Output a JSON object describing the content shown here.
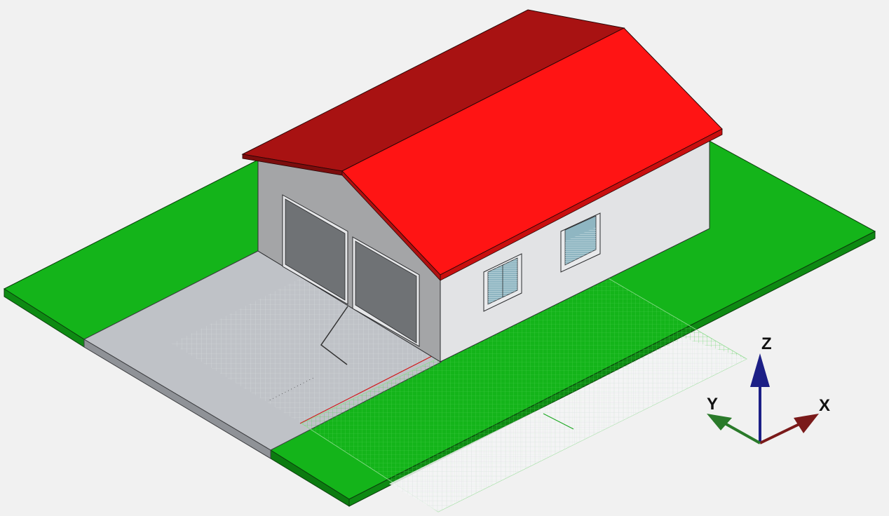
{
  "viewport": {
    "background": "#f1f1f1",
    "view_mode": "isometric 3D model view"
  },
  "model": {
    "roof_colors": {
      "back_slope": "#a81212",
      "front_slope": "#ff1414"
    },
    "wall_colors": {
      "gable": "#a4a5a7",
      "front": "#e2e3e5"
    },
    "lawn_color": "#14b41a",
    "driveway_color": "#bfc2c7",
    "garage_door_color": "#6f7275",
    "window_glass_color": "#8fb6c2"
  },
  "axes": {
    "x": {
      "label": "X",
      "color": "#7a1a1a"
    },
    "y": {
      "label": "Y",
      "color": "#2a7a2a"
    },
    "z": {
      "label": "Z",
      "color": "#1c1f86"
    }
  }
}
